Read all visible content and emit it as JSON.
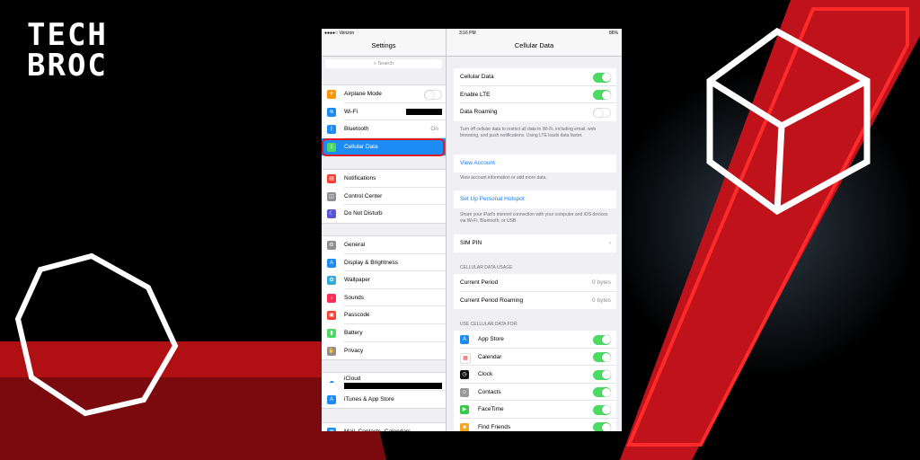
{
  "brand": {
    "line1": "TECH",
    "line2": "BROC"
  },
  "colors": {
    "accent": "#e01a22",
    "ios_blue": "#1c8cf4",
    "toggle_on": "#4cd964"
  },
  "left": {
    "carrier": "●●●●○ Verizon",
    "title": "Settings",
    "search_placeholder": "Search",
    "group1": [
      {
        "label": "Airplane Mode",
        "icon": "airplane-icon"
      },
      {
        "label": "Wi-Fi",
        "icon": "wifi-icon"
      },
      {
        "label": "Bluetooth",
        "icon": "bluetooth-icon",
        "value": "On"
      },
      {
        "label": "Cellular Data",
        "icon": "cellular-icon"
      }
    ],
    "group2": [
      {
        "label": "Notifications",
        "icon": "notifications-icon"
      },
      {
        "label": "Control Center",
        "icon": "control-center-icon"
      },
      {
        "label": "Do Not Disturb",
        "icon": "moon-icon"
      }
    ],
    "group3": [
      {
        "label": "General",
        "icon": "gear-icon"
      },
      {
        "label": "Display & Brightness",
        "icon": "display-icon"
      },
      {
        "label": "Wallpaper",
        "icon": "wallpaper-icon"
      },
      {
        "label": "Sounds",
        "icon": "sound-icon"
      },
      {
        "label": "Passcode",
        "icon": "lock-icon"
      },
      {
        "label": "Battery",
        "icon": "battery-icon"
      },
      {
        "label": "Privacy",
        "icon": "hand-icon"
      }
    ],
    "group4": [
      {
        "label": "iCloud",
        "icon": "cloud-icon"
      },
      {
        "label": "iTunes & App Store",
        "icon": "app-store-icon"
      }
    ],
    "group5": [
      {
        "label": "Mail, Contacts, Calendars",
        "icon": "mail-icon"
      }
    ]
  },
  "right": {
    "time": "3:16 PM",
    "battery": "86%",
    "title": "Cellular Data",
    "toggles": [
      {
        "label": "Cellular Data",
        "on": true
      },
      {
        "label": "Enable LTE",
        "on": true
      },
      {
        "label": "Data Roaming",
        "on": false
      }
    ],
    "note1": "Turn off cellular data to restrict all data to Wi-Fi, including email, web browsing, and push notifications. Using LTE loads data faster.",
    "view_account": "View Account",
    "note2": "View account information or add more data.",
    "hotspot": "Set Up Personal Hotspot",
    "note3": "Share your iPad's internet connection with your computer and iOS devices via Wi-Fi, Bluetooth, or USB.",
    "sim_pin": "SIM PIN",
    "usage_header": "CELLULAR DATA USAGE",
    "usage": [
      {
        "label": "Current Period",
        "value": "0 bytes"
      },
      {
        "label": "Current Period Roaming",
        "value": "0 bytes"
      }
    ],
    "apps_header": "USE CELLULAR DATA FOR:",
    "apps": [
      {
        "label": "App Store",
        "icon": "app-store-icon",
        "color": "#1a8cf4"
      },
      {
        "label": "Calendar",
        "icon": "calendar-icon",
        "color": "#ffffff"
      },
      {
        "label": "Clock",
        "icon": "clock-icon",
        "color": "#111111"
      },
      {
        "label": "Contacts",
        "icon": "contacts-icon",
        "color": "#9a9a9a"
      },
      {
        "label": "FaceTime",
        "icon": "facetime-icon",
        "color": "#37c94b"
      },
      {
        "label": "Find Friends",
        "icon": "find-friends-icon",
        "color": "#f5a623"
      }
    ]
  }
}
